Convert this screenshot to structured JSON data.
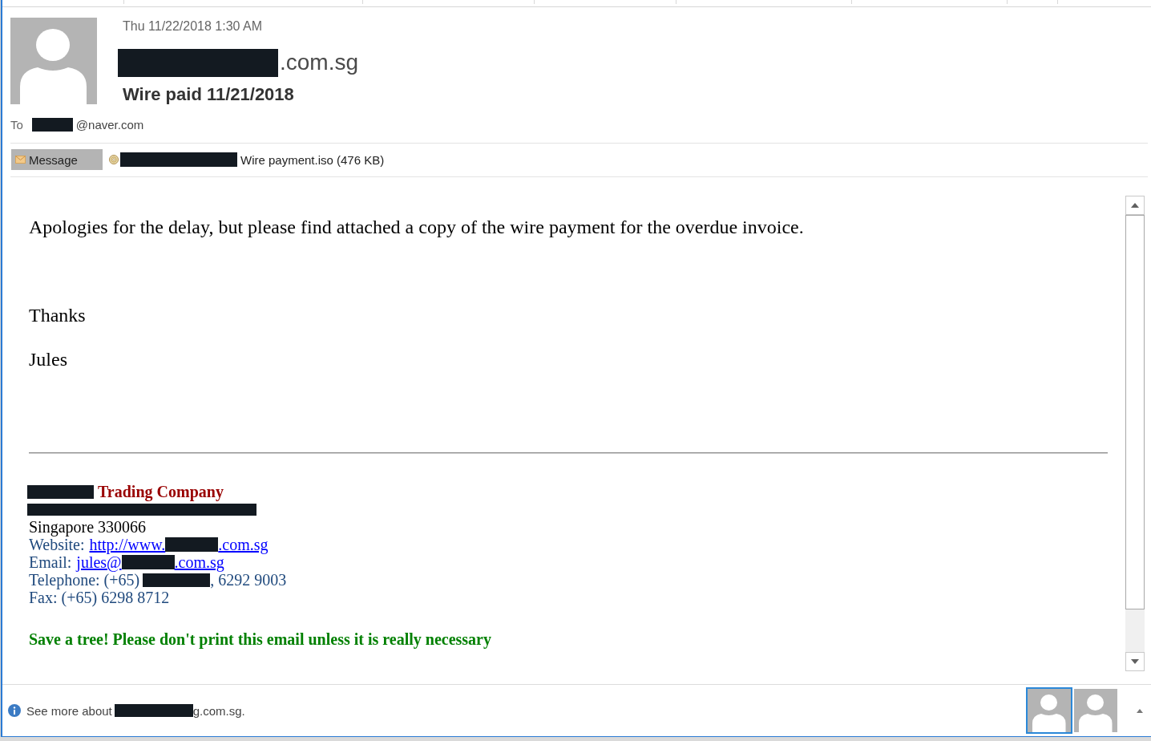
{
  "message": {
    "date": "Thu 11/22/2018 1:30 AM",
    "sender": {
      "visible_part": ".com.sg"
    },
    "subject": "Wire paid 11/21/2018",
    "to": {
      "label": "To",
      "visible_part": "@naver.com"
    }
  },
  "attachments": [
    {
      "kind": "message",
      "label": "Message",
      "selected": true
    },
    {
      "kind": "file",
      "label": "Wire payment.iso (476 KB)",
      "selected": false
    }
  ],
  "body": {
    "paragraphs": [
      "Apologies for the delay, but please find attached a copy of the wire payment for the overdue invoice.",
      "Thanks",
      "Jules"
    ]
  },
  "signature": {
    "company": "Trading Company",
    "city": "Singapore 330066",
    "website": {
      "label": "Website:",
      "link_start": "http://www.",
      "link_end": ".com.sg"
    },
    "email": {
      "label": "Email:",
      "link_start": "jules@",
      "link_end": ".com.sg"
    },
    "telephone": {
      "label": "Telephone: (+65)",
      "number_end": ", 6292 9003"
    },
    "fax": "Fax: (+65) 6298 8712",
    "note": "Save a tree! Please don't print this email unless it is really necessary"
  },
  "people_pane": {
    "text_start": "See more about",
    "text_end": "g.com.sg.",
    "people": [
      {
        "selected": true
      },
      {
        "selected": false
      }
    ]
  }
}
